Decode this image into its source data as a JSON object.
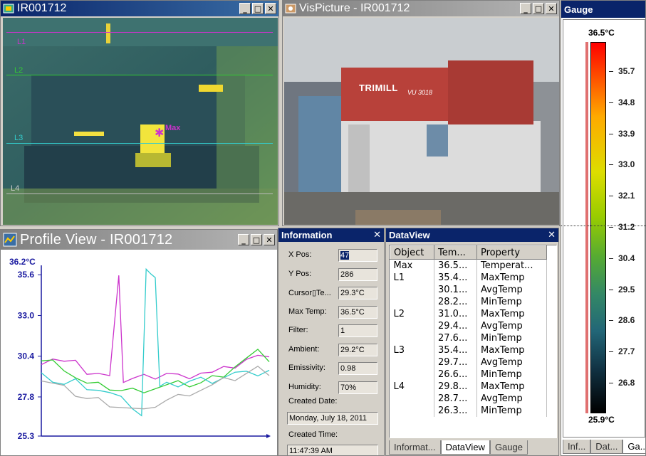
{
  "ir_window": {
    "title": "IR001712",
    "lines": [
      "L1",
      "L2",
      "L3",
      "L4"
    ],
    "max_label": "Max",
    "colors": {
      "L1": "#cc33cc",
      "L2": "#33cc33",
      "L3": "#33cccc",
      "L4": "#bbbbbb",
      "max": "#cc33cc"
    }
  },
  "vis_window": {
    "title": "VisPicture - IR001712",
    "sign_text": "TRIMILL",
    "sign_model": "VU 3018"
  },
  "gauge_window": {
    "title": "Gauge",
    "max_label": "36.5°C",
    "min_label": "25.9°C",
    "ticks": [
      "35.7",
      "34.8",
      "33.9",
      "33.0",
      "32.1",
      "31.2",
      "30.4",
      "29.5",
      "28.6",
      "27.7",
      "26.8"
    ],
    "tabs": [
      "Inf...",
      "Dat...",
      "Ga..."
    ]
  },
  "profile_window": {
    "title": "Profile View - IR001712",
    "top_label": "36.2°C"
  },
  "chart_data": {
    "type": "line",
    "title": "",
    "xlabel": "",
    "ylabel": "",
    "ylim": [
      25.3,
      36.2
    ],
    "y_ticks": [
      "35.6",
      "33.0",
      "30.4",
      "27.8",
      "25.3"
    ],
    "series": [
      {
        "color": "#cc33cc",
        "x": [
          0,
          5,
          10,
          15,
          20,
          25,
          30,
          34,
          36,
          40,
          45,
          50,
          55,
          60,
          65,
          70,
          75,
          80,
          85,
          90,
          95,
          100
        ],
        "y": [
          30.1,
          30.3,
          30.0,
          29.9,
          29.4,
          29.3,
          29.0,
          35.8,
          28.8,
          28.9,
          29.0,
          29.1,
          29.3,
          29.1,
          29.2,
          29.4,
          29.3,
          29.5,
          29.8,
          30.2,
          30.3,
          30.6
        ]
      },
      {
        "color": "#33cc33",
        "x": [
          0,
          5,
          10,
          15,
          20,
          25,
          30,
          35,
          40,
          45,
          50,
          55,
          60,
          65,
          70,
          75,
          80,
          85,
          90,
          95,
          100
        ],
        "y": [
          30.1,
          30.0,
          29.7,
          29.1,
          28.6,
          28.5,
          28.4,
          28.2,
          28.2,
          28.3,
          28.4,
          28.5,
          28.6,
          28.6,
          28.7,
          29.0,
          29.3,
          29.8,
          30.2,
          30.6,
          30.2
        ]
      },
      {
        "color": "#33cccc",
        "x": [
          0,
          5,
          10,
          15,
          20,
          25,
          30,
          35,
          40,
          44,
          46,
          48,
          50,
          52,
          55,
          60,
          65,
          70,
          75,
          80,
          85,
          90,
          95,
          100
        ],
        "y": [
          29.1,
          28.9,
          28.6,
          28.8,
          28.5,
          28.3,
          28.0,
          27.6,
          27.2,
          26.6,
          35.8,
          35.9,
          35.5,
          28.4,
          28.5,
          28.6,
          28.8,
          28.9,
          28.9,
          29.1,
          29.3,
          29.2,
          29.3,
          29.5
        ]
      },
      {
        "color": "#aaaaaa",
        "x": [
          0,
          5,
          10,
          15,
          20,
          25,
          30,
          35,
          40,
          45,
          50,
          55,
          60,
          65,
          70,
          75,
          80,
          85,
          90,
          95,
          100
        ],
        "y": [
          28.9,
          28.6,
          28.3,
          28.0,
          27.7,
          27.6,
          27.4,
          27.2,
          27.0,
          26.8,
          27.3,
          27.6,
          27.8,
          28.1,
          28.3,
          28.5,
          28.8,
          29.0,
          29.3,
          29.6,
          29.4
        ]
      }
    ]
  },
  "info_panel": {
    "title": "Information",
    "fields": [
      {
        "label": "X Pos:",
        "value": "47"
      },
      {
        "label": "Y Pos:",
        "value": "286"
      },
      {
        "label": "Cursor▯Te...",
        "value": "29.3°C"
      },
      {
        "label": "Max Temp:",
        "value": "36.5°C"
      },
      {
        "label": "Filter:",
        "value": "1"
      },
      {
        "label": "Ambient:",
        "value": "29.2°C"
      },
      {
        "label": "Emissivity:",
        "value": "0.98"
      },
      {
        "label": "Humidity:",
        "value": "70%"
      }
    ],
    "created_date_label": "Created Date:",
    "created_date": "Monday, July 18, 2011",
    "created_time_label": "Created Time:",
    "created_time": "11:47:39 AM"
  },
  "dataview_panel": {
    "title": "DataView",
    "columns": [
      "Object",
      "Tem...",
      "Property"
    ],
    "rows": [
      [
        "Max",
        "36.5...",
        "Temperat..."
      ],
      [
        "L1",
        "35.4...",
        "MaxTemp"
      ],
      [
        "",
        "30.1...",
        "AvgTemp"
      ],
      [
        "",
        "28.2...",
        "MinTemp"
      ],
      [
        "L2",
        "31.0...",
        "MaxTemp"
      ],
      [
        "",
        "29.4...",
        "AvgTemp"
      ],
      [
        "",
        "27.6...",
        "MinTemp"
      ],
      [
        "L3",
        "35.4...",
        "MaxTemp"
      ],
      [
        "",
        "29.7...",
        "AvgTemp"
      ],
      [
        "",
        "26.6...",
        "MinTemp"
      ],
      [
        "L4",
        "29.8...",
        "MaxTemp"
      ],
      [
        "",
        "28.7...",
        "AvgTemp"
      ],
      [
        "",
        "26.3...",
        "MinTemp"
      ]
    ],
    "tabs": [
      "Informat...",
      "DataView",
      "Gauge"
    ]
  }
}
